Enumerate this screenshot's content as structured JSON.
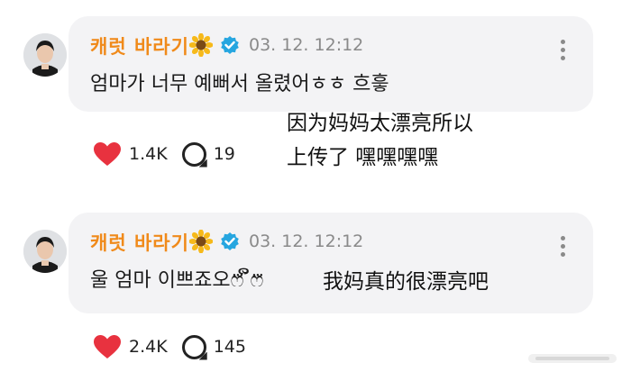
{
  "comments": [
    {
      "username": "캐럿 바라기",
      "timestamp": "03. 12. 12:12",
      "text": "엄마가 너무 예뻐서 올렸어ㅎㅎ 흐흫",
      "subtitle_lines": [
        "因为妈妈太漂亮所以",
        "上传了 嘿嘿嘿嘿"
      ],
      "likes": "1.4K",
      "replies": "19"
    },
    {
      "username": "캐럿 바라기",
      "timestamp": "03. 12. 12:12",
      "text": "울 엄마 이쁘죠오ෆ⃛ ິ̆ෆ⃛",
      "subtitle_lines": [
        "我妈真的很漂亮吧"
      ],
      "likes": "2.4K",
      "replies": "145"
    }
  ],
  "icons": {
    "avatar": "avatar",
    "flower": "sunflower-icon",
    "verified": "verified-icon",
    "more": "more-vertical-icon",
    "like": "heart-icon",
    "reply": "reply-bubble-icon"
  },
  "colors": {
    "username": "#f08a1a",
    "heart": "#e8323f",
    "verified": "#26a6e0",
    "bubble": "#f3f3f5"
  }
}
